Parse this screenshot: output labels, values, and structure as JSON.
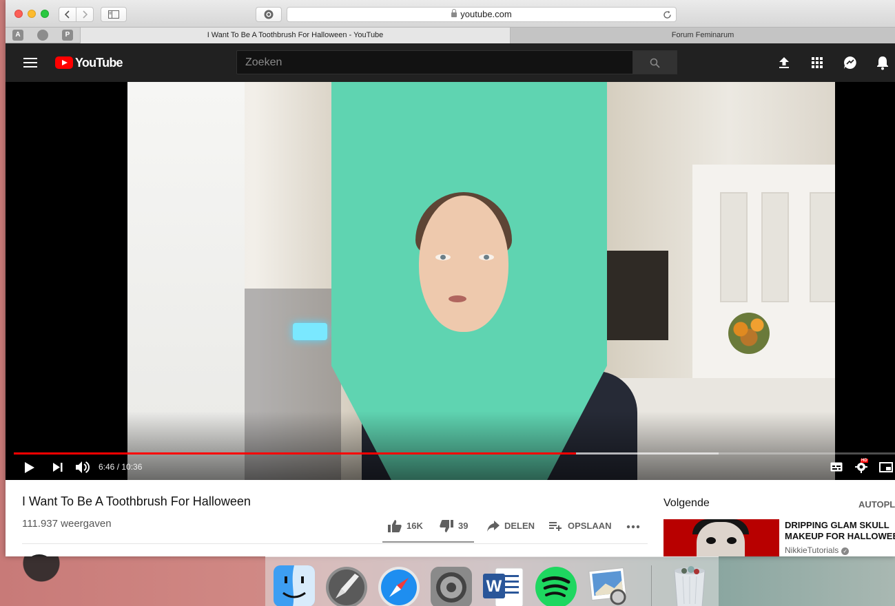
{
  "browser": {
    "url": "youtube.com",
    "pinned_tabs": [
      "A",
      "",
      "P"
    ],
    "tabs": [
      {
        "label": "I Want To Be A Toothbrush For Halloween - YouTube",
        "active": true
      },
      {
        "label": "Forum Feminarum",
        "active": false
      }
    ]
  },
  "youtube": {
    "logo_text": "YouTube",
    "search_placeholder": "Zoeken",
    "header_icons": [
      "upload-icon",
      "apps-grid-icon",
      "messages-icon",
      "notifications-bell-icon"
    ]
  },
  "player": {
    "current_time": "6:46",
    "duration": "10:36",
    "time_display": "6:46 / 10:36",
    "progress_fraction": 0.638,
    "buffered_fraction": 0.8,
    "hd_badge": "HD",
    "accent_color": "#ff0000"
  },
  "video": {
    "title": "I Want To Be A Toothbrush For Halloween",
    "views": "111.937 weergaven",
    "likes": "16K",
    "dislikes": "39",
    "share_label": "DELEN",
    "save_label": "OPSLAAN"
  },
  "sidebar": {
    "next_label": "Volgende",
    "autoplay_label": "AUTOPLAY",
    "recommendation": {
      "title_line1": "DRIPPING GLAM SKULL",
      "title_line2": "MAKEUP FOR HALLOWEEN",
      "channel": "NikkieTutorials",
      "verified": true
    }
  },
  "dock": {
    "apps": [
      "finder-icon",
      "launchpad-icon",
      "safari-icon",
      "system-preferences-icon",
      "word-icon",
      "spotify-icon",
      "preview-icon",
      "trash-icon"
    ]
  }
}
